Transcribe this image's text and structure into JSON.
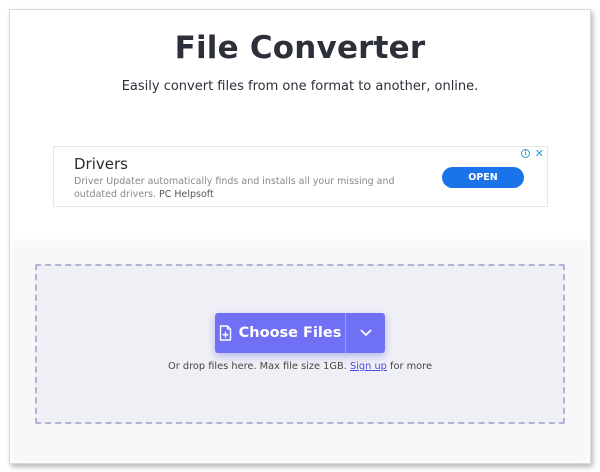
{
  "header": {
    "title": "File Converter",
    "subtitle": "Easily convert files from one format to another, online."
  },
  "ad": {
    "title": "Drivers",
    "description": "Driver Updater automatically finds and installs all your missing and outdated drivers.",
    "brand": "PC Helpsoft",
    "cta_label": "OPEN",
    "choices_icon": "adchoices-icon",
    "close_icon": "close-icon",
    "cta_color": "#1a73e8"
  },
  "upload": {
    "choose_label": "Choose Files",
    "choose_icon": "file-add-icon",
    "dropdown_icon": "chevron-down-icon",
    "drop_text_before": "Or drop files here. Max file size 1GB.",
    "signup_label": "Sign up",
    "drop_text_after": "for more",
    "accent_color": "#7070f4"
  }
}
